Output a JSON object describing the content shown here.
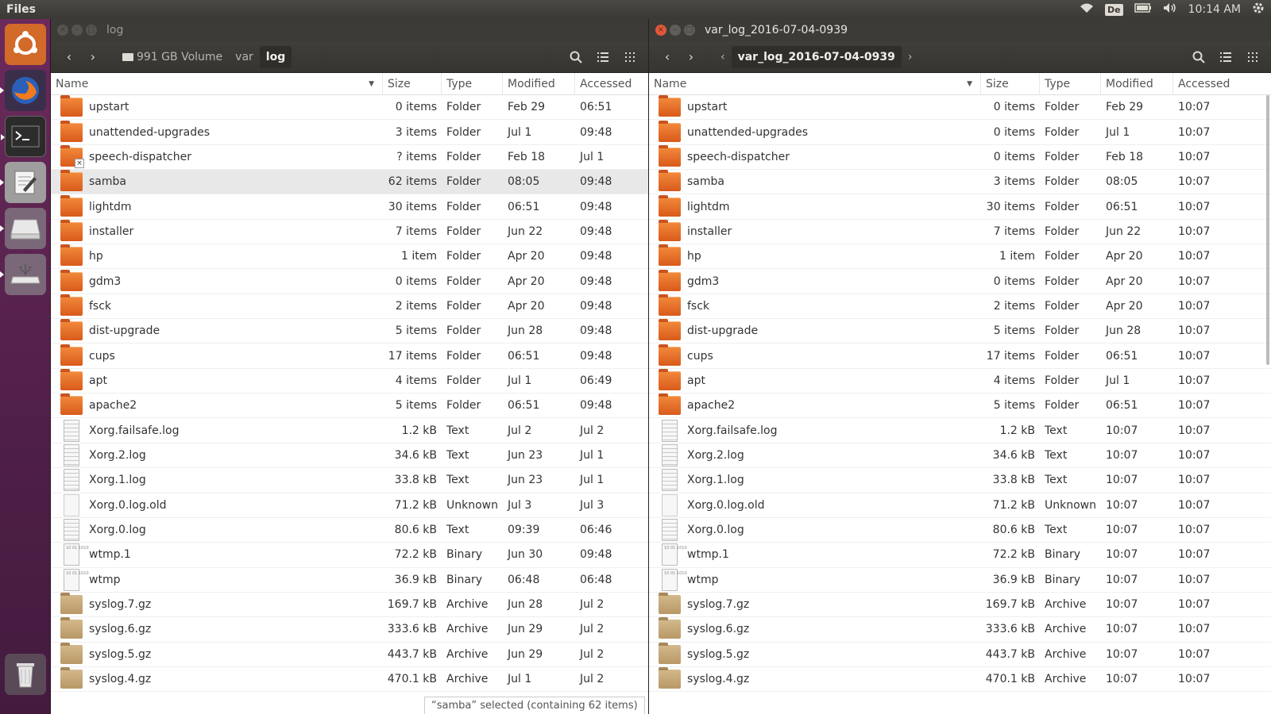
{
  "topbar": {
    "app_name": "Files",
    "keyboard": "De",
    "time": "10:14 AM"
  },
  "left": {
    "title": "log",
    "breadcrumbs": [
      "991 GB Volume",
      "var",
      "log"
    ],
    "columns": [
      "Name",
      "Size",
      "Type",
      "Modified",
      "Accessed"
    ],
    "status": "“samba” selected  (containing 62 items)",
    "rows": [
      {
        "name": "upstart",
        "size": "0 items",
        "type": "Folder",
        "modified": "Feb 29",
        "accessed": "06:51",
        "icon": "folder"
      },
      {
        "name": "unattended-upgrades",
        "size": "3 items",
        "type": "Folder",
        "modified": "Jul 1",
        "accessed": "09:48",
        "icon": "folder"
      },
      {
        "name": "speech-dispatcher",
        "size": "? items",
        "type": "Folder",
        "modified": "Feb 18",
        "accessed": "Jul 1",
        "icon": "folder-locked"
      },
      {
        "name": "samba",
        "size": "62 items",
        "type": "Folder",
        "modified": "08:05",
        "accessed": "09:48",
        "icon": "folder",
        "selected": true
      },
      {
        "name": "lightdm",
        "size": "30 items",
        "type": "Folder",
        "modified": "06:51",
        "accessed": "09:48",
        "icon": "folder"
      },
      {
        "name": "installer",
        "size": "7 items",
        "type": "Folder",
        "modified": "Jun 22",
        "accessed": "09:48",
        "icon": "folder"
      },
      {
        "name": "hp",
        "size": "1 item",
        "type": "Folder",
        "modified": "Apr 20",
        "accessed": "09:48",
        "icon": "folder"
      },
      {
        "name": "gdm3",
        "size": "0 items",
        "type": "Folder",
        "modified": "Apr 20",
        "accessed": "09:48",
        "icon": "folder"
      },
      {
        "name": "fsck",
        "size": "2 items",
        "type": "Folder",
        "modified": "Apr 20",
        "accessed": "09:48",
        "icon": "folder"
      },
      {
        "name": "dist-upgrade",
        "size": "5 items",
        "type": "Folder",
        "modified": "Jun 28",
        "accessed": "09:48",
        "icon": "folder"
      },
      {
        "name": "cups",
        "size": "17 items",
        "type": "Folder",
        "modified": "06:51",
        "accessed": "09:48",
        "icon": "folder"
      },
      {
        "name": "apt",
        "size": "4 items",
        "type": "Folder",
        "modified": "Jul 1",
        "accessed": "06:49",
        "icon": "folder"
      },
      {
        "name": "apache2",
        "size": "5 items",
        "type": "Folder",
        "modified": "06:51",
        "accessed": "09:48",
        "icon": "folder"
      },
      {
        "name": "Xorg.failsafe.log",
        "size": "1.2 kB",
        "type": "Text",
        "modified": "Jul 2",
        "accessed": "Jul 2",
        "icon": "text"
      },
      {
        "name": "Xorg.2.log",
        "size": "34.6 kB",
        "type": "Text",
        "modified": "Jun 23",
        "accessed": "Jul 1",
        "icon": "text"
      },
      {
        "name": "Xorg.1.log",
        "size": "33.8 kB",
        "type": "Text",
        "modified": "Jun 23",
        "accessed": "Jul 1",
        "icon": "text"
      },
      {
        "name": "Xorg.0.log.old",
        "size": "71.2 kB",
        "type": "Unknown",
        "modified": "Jul 3",
        "accessed": "Jul 3",
        "icon": "unknown"
      },
      {
        "name": "Xorg.0.log",
        "size": "80.6 kB",
        "type": "Text",
        "modified": "09:39",
        "accessed": "06:46",
        "icon": "text"
      },
      {
        "name": "wtmp.1",
        "size": "72.2 kB",
        "type": "Binary",
        "modified": "Jun 30",
        "accessed": "09:48",
        "icon": "binary"
      },
      {
        "name": "wtmp",
        "size": "36.9 kB",
        "type": "Binary",
        "modified": "06:48",
        "accessed": "06:48",
        "icon": "binary"
      },
      {
        "name": "syslog.7.gz",
        "size": "169.7 kB",
        "type": "Archive",
        "modified": "Jun 28",
        "accessed": "Jul 2",
        "icon": "archive"
      },
      {
        "name": "syslog.6.gz",
        "size": "333.6 kB",
        "type": "Archive",
        "modified": "Jun 29",
        "accessed": "Jul 2",
        "icon": "archive"
      },
      {
        "name": "syslog.5.gz",
        "size": "443.7 kB",
        "type": "Archive",
        "modified": "Jun 29",
        "accessed": "Jul 2",
        "icon": "archive"
      },
      {
        "name": "syslog.4.gz",
        "size": "470.1 kB",
        "type": "Archive",
        "modified": "Jul 1",
        "accessed": "Jul 2",
        "icon": "archive"
      }
    ]
  },
  "right": {
    "title": "var_log_2016-07-04-0939",
    "breadcrumbs": [
      "var_log_2016-07-04-0939"
    ],
    "columns": [
      "Name",
      "Size",
      "Type",
      "Modified",
      "Accessed"
    ],
    "rows": [
      {
        "name": "upstart",
        "size": "0 items",
        "type": "Folder",
        "modified": "Feb 29",
        "accessed": "10:07",
        "icon": "folder"
      },
      {
        "name": "unattended-upgrades",
        "size": "0 items",
        "type": "Folder",
        "modified": "Jul 1",
        "accessed": "10:07",
        "icon": "folder"
      },
      {
        "name": "speech-dispatcher",
        "size": "0 items",
        "type": "Folder",
        "modified": "Feb 18",
        "accessed": "10:07",
        "icon": "folder"
      },
      {
        "name": "samba",
        "size": "3 items",
        "type": "Folder",
        "modified": "08:05",
        "accessed": "10:07",
        "icon": "folder"
      },
      {
        "name": "lightdm",
        "size": "30 items",
        "type": "Folder",
        "modified": "06:51",
        "accessed": "10:07",
        "icon": "folder"
      },
      {
        "name": "installer",
        "size": "7 items",
        "type": "Folder",
        "modified": "Jun 22",
        "accessed": "10:07",
        "icon": "folder"
      },
      {
        "name": "hp",
        "size": "1 item",
        "type": "Folder",
        "modified": "Apr 20",
        "accessed": "10:07",
        "icon": "folder"
      },
      {
        "name": "gdm3",
        "size": "0 items",
        "type": "Folder",
        "modified": "Apr 20",
        "accessed": "10:07",
        "icon": "folder"
      },
      {
        "name": "fsck",
        "size": "2 items",
        "type": "Folder",
        "modified": "Apr 20",
        "accessed": "10:07",
        "icon": "folder"
      },
      {
        "name": "dist-upgrade",
        "size": "5 items",
        "type": "Folder",
        "modified": "Jun 28",
        "accessed": "10:07",
        "icon": "folder"
      },
      {
        "name": "cups",
        "size": "17 items",
        "type": "Folder",
        "modified": "06:51",
        "accessed": "10:07",
        "icon": "folder"
      },
      {
        "name": "apt",
        "size": "4 items",
        "type": "Folder",
        "modified": "Jul 1",
        "accessed": "10:07",
        "icon": "folder"
      },
      {
        "name": "apache2",
        "size": "5 items",
        "type": "Folder",
        "modified": "06:51",
        "accessed": "10:07",
        "icon": "folder"
      },
      {
        "name": "Xorg.failsafe.log",
        "size": "1.2 kB",
        "type": "Text",
        "modified": "10:07",
        "accessed": "10:07",
        "icon": "text"
      },
      {
        "name": "Xorg.2.log",
        "size": "34.6 kB",
        "type": "Text",
        "modified": "10:07",
        "accessed": "10:07",
        "icon": "text"
      },
      {
        "name": "Xorg.1.log",
        "size": "33.8 kB",
        "type": "Text",
        "modified": "10:07",
        "accessed": "10:07",
        "icon": "text"
      },
      {
        "name": "Xorg.0.log.old",
        "size": "71.2 kB",
        "type": "Unknown",
        "modified": "10:07",
        "accessed": "10:07",
        "icon": "unknown"
      },
      {
        "name": "Xorg.0.log",
        "size": "80.6 kB",
        "type": "Text",
        "modified": "10:07",
        "accessed": "10:07",
        "icon": "text"
      },
      {
        "name": "wtmp.1",
        "size": "72.2 kB",
        "type": "Binary",
        "modified": "10:07",
        "accessed": "10:07",
        "icon": "binary"
      },
      {
        "name": "wtmp",
        "size": "36.9 kB",
        "type": "Binary",
        "modified": "10:07",
        "accessed": "10:07",
        "icon": "binary"
      },
      {
        "name": "syslog.7.gz",
        "size": "169.7 kB",
        "type": "Archive",
        "modified": "10:07",
        "accessed": "10:07",
        "icon": "archive"
      },
      {
        "name": "syslog.6.gz",
        "size": "333.6 kB",
        "type": "Archive",
        "modified": "10:07",
        "accessed": "10:07",
        "icon": "archive"
      },
      {
        "name": "syslog.5.gz",
        "size": "443.7 kB",
        "type": "Archive",
        "modified": "10:07",
        "accessed": "10:07",
        "icon": "archive"
      },
      {
        "name": "syslog.4.gz",
        "size": "470.1 kB",
        "type": "Archive",
        "modified": "10:07",
        "accessed": "10:07",
        "icon": "archive"
      }
    ]
  },
  "launcher": {
    "items": [
      "ubuntu-icon",
      "firefox-icon",
      "terminal-icon",
      "text-editor-icon",
      "drive-icon",
      "usb-drive-icon",
      "trash-icon"
    ]
  }
}
